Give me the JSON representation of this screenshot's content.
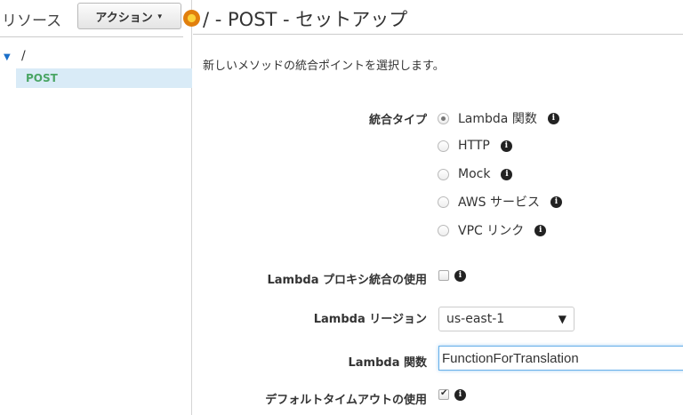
{
  "sidebar": {
    "title": "リソース",
    "actions_label": "アクション",
    "tree": {
      "root_label": "/",
      "method_label": "POST"
    }
  },
  "main": {
    "title": "/ - POST - セットアップ",
    "subtitle": "新しいメソッドの統合ポイントを選択します。",
    "integration_type": {
      "label": "統合タイプ",
      "selected": "Lambda 関数",
      "options": [
        {
          "label": "Lambda 関数",
          "checked": true
        },
        {
          "label": "HTTP",
          "checked": false
        },
        {
          "label": "Mock",
          "checked": false
        },
        {
          "label": "AWS サービス",
          "checked": false
        },
        {
          "label": "VPC リンク",
          "checked": false
        }
      ]
    },
    "lambda_proxy": {
      "label": "Lambda プロキシ統合の使用",
      "checked": false
    },
    "lambda_region": {
      "label": "Lambda リージョン",
      "value": "us-east-1"
    },
    "lambda_function": {
      "label": "Lambda 関数",
      "value": "FunctionForTranslation"
    },
    "default_timeout": {
      "label": "デフォルトタイムアウトの使用",
      "checked": true
    }
  },
  "icons": {
    "info": "info-icon",
    "status": "status-dot-icon",
    "dropdown": "chevron-down-icon",
    "tree_toggle": "caret-down-icon"
  },
  "colors": {
    "accent_blue": "#1a6fc9",
    "method_green": "#4aa564",
    "selected_row_bg": "#d9ebf7",
    "status_orange": "#e17f0d"
  }
}
